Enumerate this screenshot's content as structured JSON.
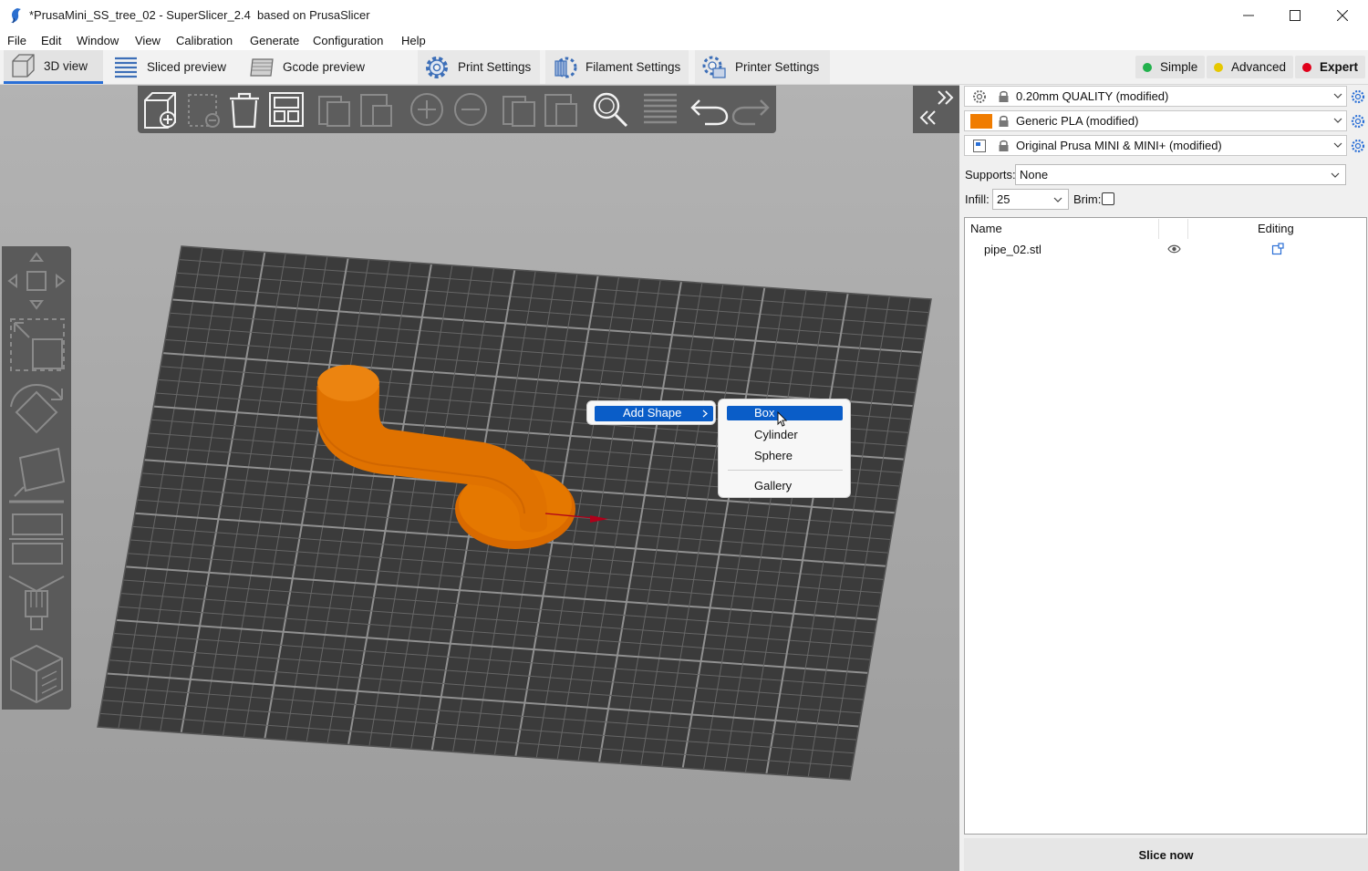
{
  "window": {
    "title": "*PrusaMini_SS_tree_02 - SuperSlicer_2.4  based on PrusaSlicer"
  },
  "menu": [
    "File",
    "Edit",
    "Window",
    "View",
    "Calibration",
    "Generate",
    "Configuration",
    "Help"
  ],
  "tabs": {
    "view3d": "3D view",
    "sliced": "Sliced preview",
    "gcode": "Gcode preview",
    "print": "Print Settings",
    "filament": "Filament Settings",
    "printer": "Printer Settings"
  },
  "modes": {
    "simple": "Simple",
    "advanced": "Advanced",
    "expert": "Expert",
    "colors": {
      "simple": "#22b14c",
      "advanced": "#e6c800",
      "expert": "#e0001a"
    }
  },
  "presets": {
    "print": "0.20mm QUALITY (modified)",
    "filament": "Generic PLA (modified)",
    "printer": "Original Prusa MINI & MINI+ (modified)",
    "filament_color": "#f07c00"
  },
  "settings": {
    "supports_label": "Supports:",
    "supports_value": "None",
    "infill_label": "Infill:",
    "infill_value": "25",
    "brim_label": "Brim:",
    "brim_checked": false
  },
  "object_list": {
    "columns": {
      "name": "Name",
      "editing": "Editing"
    },
    "items": [
      {
        "name": "pipe_02.stl"
      }
    ]
  },
  "slice_button": "Slice now",
  "context_menu": {
    "add_shape": "Add Shape",
    "submenu": {
      "box": "Box",
      "cylinder": "Cylinder",
      "sphere": "Sphere",
      "gallery": "Gallery"
    },
    "highlighted": "Box"
  },
  "model": {
    "color": "#e87400"
  }
}
